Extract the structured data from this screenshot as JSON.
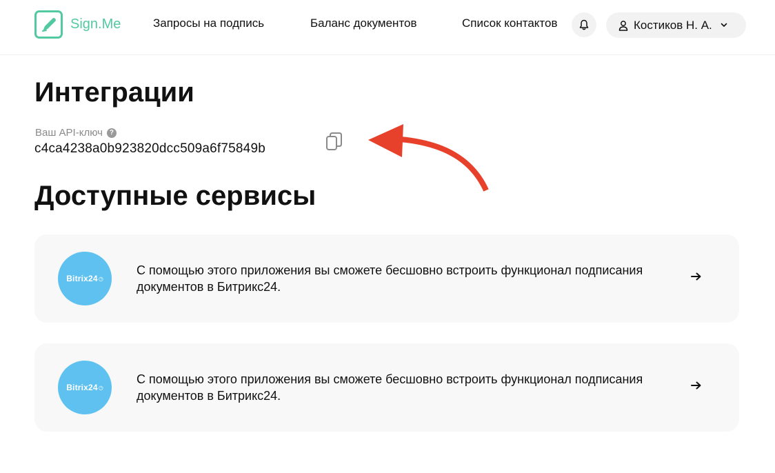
{
  "header": {
    "logo_text": "Sign.Me",
    "nav": [
      {
        "label": "Запросы на подпись"
      },
      {
        "label": "Баланс документов"
      },
      {
        "label": "Список контактов"
      }
    ],
    "bell_icon": "bell-icon",
    "user": {
      "name": "Костиков Н. А.",
      "icon": "user-icon",
      "chevron": "chevron-down-icon"
    }
  },
  "page": {
    "title": "Интеграции",
    "api_label": "Ваш API-ключ",
    "help_glyph": "?",
    "api_key": "c4ca4238a0b923820dcc509a6f75849b",
    "copy_icon": "copy-icon",
    "annotation_color": "#e8412b"
  },
  "services": {
    "title": "Доступные сервисы",
    "items": [
      {
        "logo_text": "Bitrix24",
        "logo_symbol": "◷",
        "logo_color": "#5ec1f0",
        "description": "С помощью этого приложения вы сможете бесшовно встроить функционал подписания документов в Битрикс24.",
        "arrow_icon": "arrow-right-icon"
      },
      {
        "logo_text": "Bitrix24",
        "logo_symbol": "◷",
        "logo_color": "#5ec1f0",
        "description": "С помощью этого приложения вы сможете бесшовно встроить функционал подписания документов в Битрикс24.",
        "arrow_icon": "arrow-right-icon"
      }
    ]
  },
  "colors": {
    "brand": "#52c9a0",
    "card_bg": "#f8f8f8",
    "pill_bg": "#f2f2f2"
  }
}
